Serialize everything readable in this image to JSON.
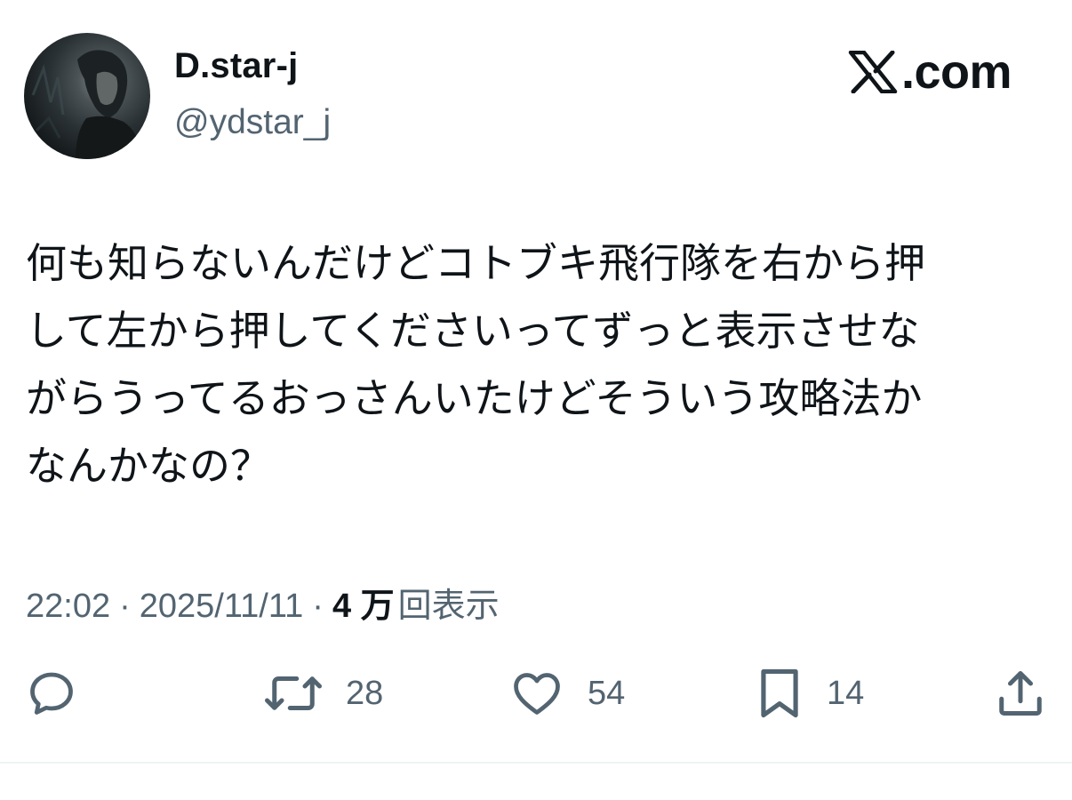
{
  "author": {
    "display_name": "D.star-j",
    "handle": "@ydstar_j",
    "avatar": "avatar-photo"
  },
  "brand": {
    "icon": "x-logo-icon",
    "domain_suffix": ".com"
  },
  "tweet": {
    "text": "何も知らないんだけどコトブキ飛行隊を右から押\nして左から押してくださいってずっと表示させな\nがらうってるおっさんいたけどそういう攻略法か\nなんかなの？",
    "time": "22:02",
    "date": "2025/11/11",
    "separator": "·",
    "views_count": "4 万",
    "views_label": "回表示"
  },
  "actions": {
    "reply": {
      "icon": "reply-icon"
    },
    "retweet": {
      "icon": "retweet-icon",
      "count": "28"
    },
    "like": {
      "icon": "heart-icon",
      "count": "54"
    },
    "bookmark": {
      "icon": "bookmark-icon",
      "count": "14"
    },
    "share": {
      "icon": "share-icon"
    }
  },
  "colors": {
    "text_primary": "#0f1419",
    "text_secondary": "#536471",
    "divider": "#eff3f4"
  }
}
